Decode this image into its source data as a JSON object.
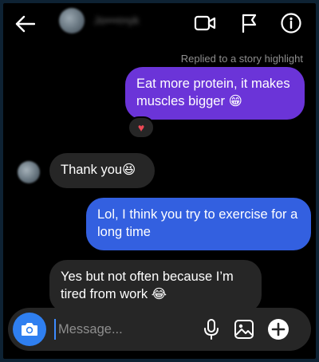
{
  "header": {
    "back_icon": "arrow-left-icon",
    "username": "Jo•••n•yk",
    "video_icon": "video-call-icon",
    "flag_icon": "flag-icon",
    "info_icon": "info-icon"
  },
  "thread": {
    "context_label": "Replied to a story highlight",
    "messages": [
      {
        "sender": "me",
        "text": "Eat more protein, it makes muscles bigger",
        "emoji": "😁",
        "bubble_color": "#6b34d8"
      },
      {
        "sender": "them",
        "text": "Thank you",
        "emoji": "😆",
        "bubble_color": "#262626"
      },
      {
        "sender": "me",
        "text": "Lol, I think you try to exercise for a long time",
        "emoji": "",
        "bubble_color": "#3360e0"
      },
      {
        "sender": "them",
        "text": "Yes but not often because I’m tired from work",
        "emoji": "😂",
        "bubble_color": "#262626"
      }
    ],
    "reaction": "♥"
  },
  "composer": {
    "placeholder": "Message...",
    "camera_icon": "camera-icon",
    "mic_icon": "microphone-icon",
    "gallery_icon": "gallery-icon",
    "add_icon": "add-icon",
    "camera_color": "#2f7ff0"
  },
  "colors": {
    "background": "#000000",
    "outgoing_purple": "#6b34d8",
    "outgoing_blue": "#3360e0",
    "incoming": "#262626",
    "reaction_heart": "#ed4956"
  }
}
